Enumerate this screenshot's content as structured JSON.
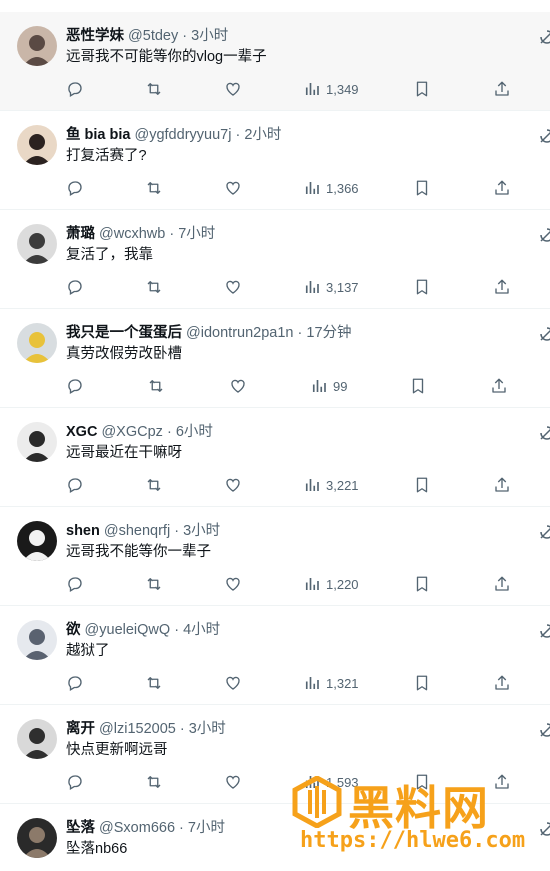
{
  "tweets": [
    {
      "name": "恶性学妹",
      "handle": "@5tdey",
      "time": "3小时",
      "text": "远哥我不可能等你的vlog一辈子",
      "views": "1,349",
      "avatar": "#c9b6a8",
      "avatar2": "#5a4a44"
    },
    {
      "name": "鱼 bia bia",
      "handle": "@ygfddryyuu7j",
      "time": "2小时",
      "text": "打复活赛了?",
      "views": "1,366",
      "avatar": "#e9d8c6",
      "avatar2": "#2b2220"
    },
    {
      "name": "萧璐",
      "handle": "@wcxhwb",
      "time": "7小时",
      "text": "复活了，我靠",
      "views": "3,137",
      "avatar": "#dcdcdc",
      "avatar2": "#3b3b3b"
    },
    {
      "name": "我只是一个蛋蛋后",
      "handle": "@idontrun2pa1n",
      "time": "17分钟",
      "text": "真劳改假劳改卧槽",
      "views": "99",
      "avatar": "#d8dde0",
      "avatar2": "#e8c23a"
    },
    {
      "name": "XGC",
      "handle": "@XGCpz",
      "time": "6小时",
      "text": "远哥最近在干嘛呀",
      "views": "3,221",
      "avatar": "#ececec",
      "avatar2": "#2a2a2a"
    },
    {
      "name": "shen",
      "handle": "@shenqrfj",
      "time": "3小时",
      "text": "远哥我不能等你一辈子",
      "views": "1,220",
      "avatar": "#1a1a1a",
      "avatar2": "#f2f2f2"
    },
    {
      "name": "欲",
      "handle": "@yueleiQwQ",
      "time": "4小时",
      "text": "越狱了",
      "views": "1,321",
      "avatar": "#e6e9ee",
      "avatar2": "#5a6270"
    },
    {
      "name": "离开",
      "handle": "@lzi152005",
      "time": "3小时",
      "text": "快点更新啊远哥",
      "views": "1,593",
      "avatar": "#d9d9d9",
      "avatar2": "#2f2f2f"
    },
    {
      "name": "坠落",
      "handle": "@Sxom666",
      "time": "7小时",
      "text": "坠落nb66",
      "views": "",
      "avatar": "#2a2a2a",
      "avatar2": "#8c7a6a"
    }
  ],
  "separator": " · ",
  "icons": {
    "reply": "reply-icon",
    "repost": "repost-icon",
    "like": "like-icon",
    "views": "views-icon",
    "bookmark": "bookmark-icon",
    "share": "share-icon",
    "more": "grok-icon"
  },
  "colors": {
    "icon": "#536471",
    "name": "#0f1419",
    "handle": "#536471",
    "highlight": "#f7f7f7",
    "watermark": "#f6a11a"
  },
  "watermark": {
    "title": "黑料网",
    "url": "https://hlwe6.com"
  }
}
